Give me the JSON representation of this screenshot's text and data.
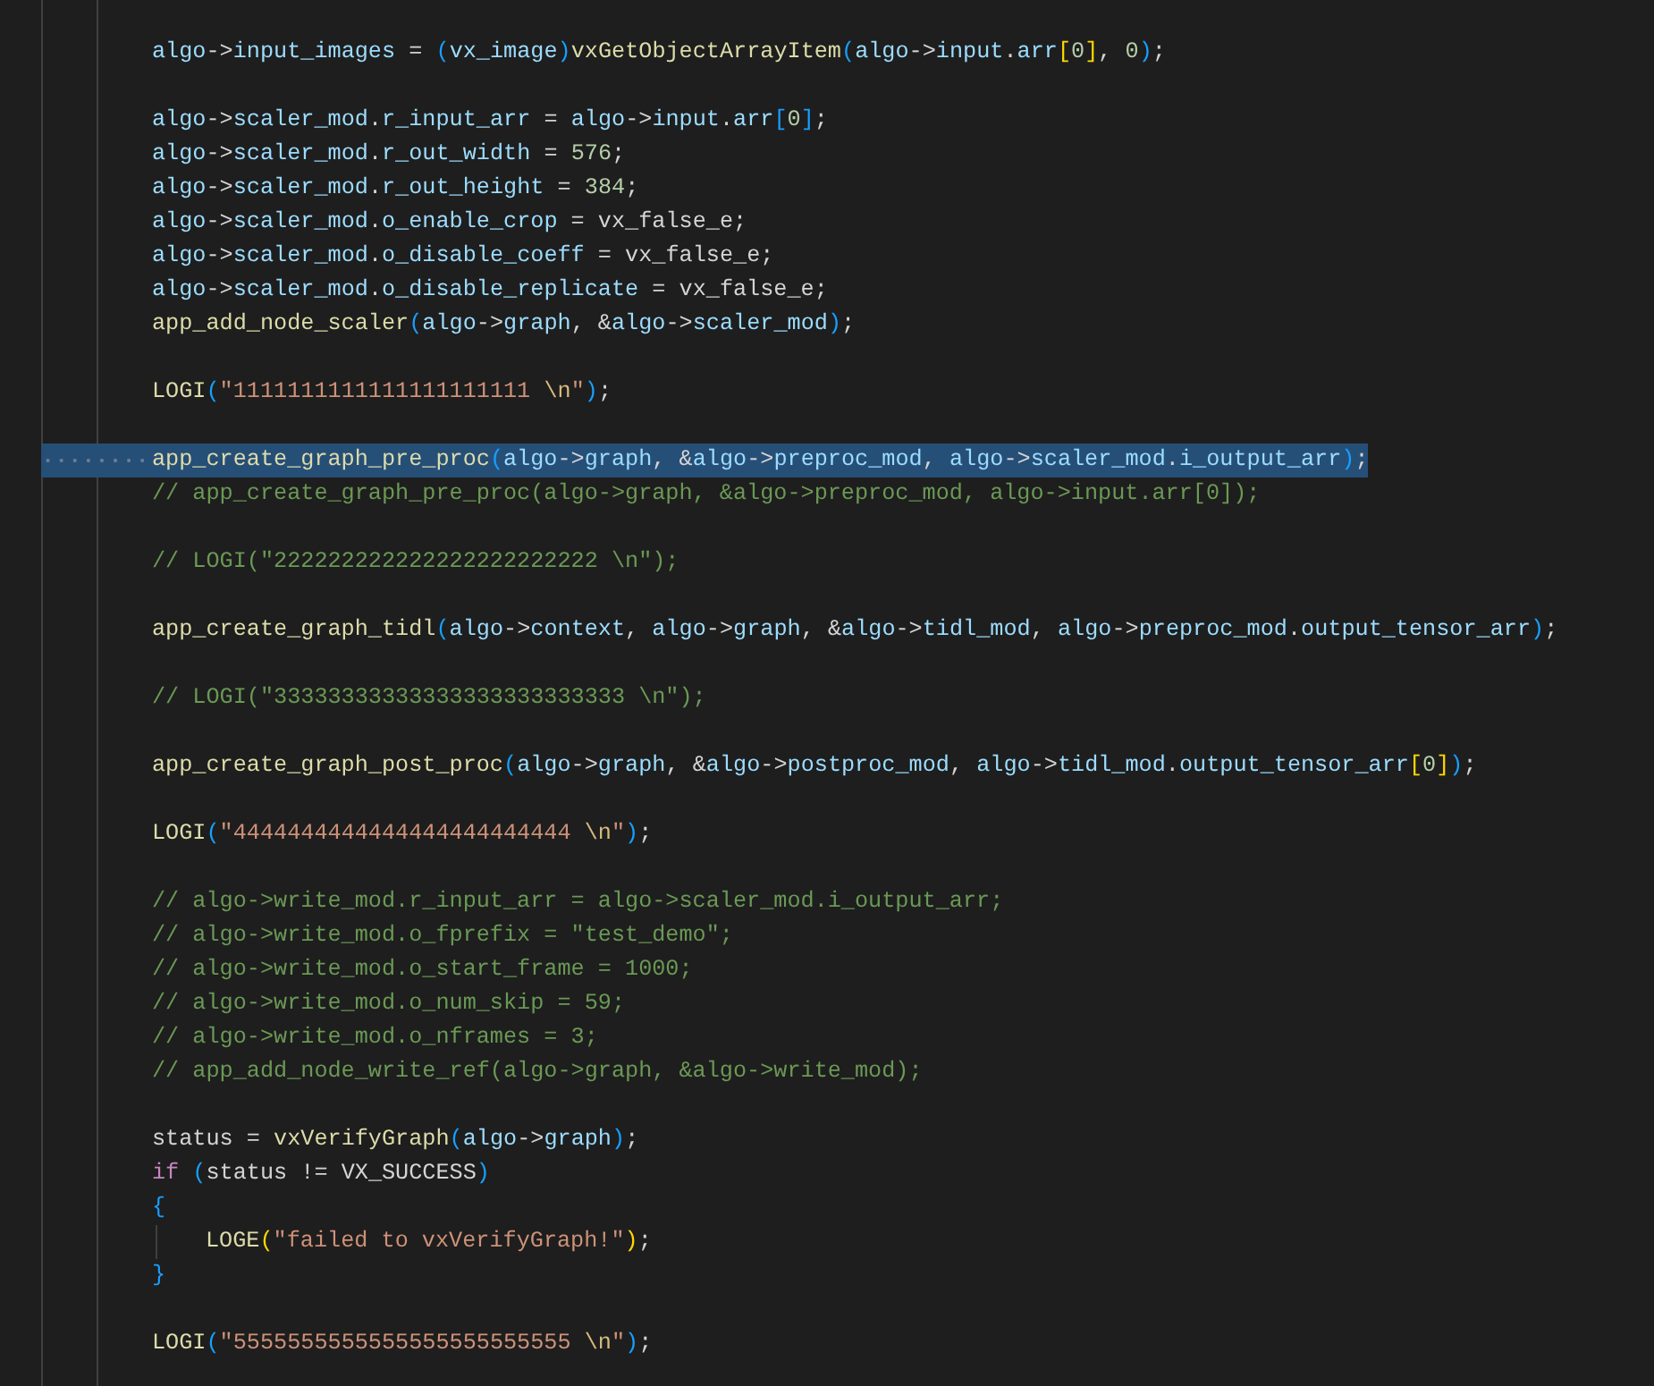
{
  "editor": {
    "lines": [
      {
        "kind": "code",
        "selected": false,
        "segments": [
          {
            "kind": "v",
            "text": "algo"
          },
          {
            "kind": "p",
            "text": "->"
          },
          {
            "kind": "v",
            "text": "input_images"
          },
          {
            "kind": "p",
            "text": " = "
          },
          {
            "kind": "b3",
            "text": "("
          },
          {
            "kind": "v",
            "text": "vx_image"
          },
          {
            "kind": "b3",
            "text": ")"
          },
          {
            "kind": "f",
            "text": "vxGetObjectArrayItem"
          },
          {
            "kind": "b3",
            "text": "("
          },
          {
            "kind": "v",
            "text": "algo"
          },
          {
            "kind": "p",
            "text": "->"
          },
          {
            "kind": "v",
            "text": "input"
          },
          {
            "kind": "p",
            "text": "."
          },
          {
            "kind": "v",
            "text": "arr"
          },
          {
            "kind": "b1",
            "text": "["
          },
          {
            "kind": "n",
            "text": "0"
          },
          {
            "kind": "b1",
            "text": "]"
          },
          {
            "kind": "p",
            "text": ", "
          },
          {
            "kind": "n",
            "text": "0"
          },
          {
            "kind": "b3",
            "text": ")"
          },
          {
            "kind": "p",
            "text": ";"
          }
        ]
      },
      {
        "kind": "blank"
      },
      {
        "kind": "code",
        "selected": false,
        "segments": [
          {
            "kind": "v",
            "text": "algo"
          },
          {
            "kind": "p",
            "text": "->"
          },
          {
            "kind": "v",
            "text": "scaler_mod"
          },
          {
            "kind": "p",
            "text": "."
          },
          {
            "kind": "v",
            "text": "r_input_arr"
          },
          {
            "kind": "p",
            "text": " = "
          },
          {
            "kind": "v",
            "text": "algo"
          },
          {
            "kind": "p",
            "text": "->"
          },
          {
            "kind": "v",
            "text": "input"
          },
          {
            "kind": "p",
            "text": "."
          },
          {
            "kind": "v",
            "text": "arr"
          },
          {
            "kind": "b3",
            "text": "["
          },
          {
            "kind": "n",
            "text": "0"
          },
          {
            "kind": "b3",
            "text": "]"
          },
          {
            "kind": "p",
            "text": ";"
          }
        ]
      },
      {
        "kind": "code",
        "selected": false,
        "segments": [
          {
            "kind": "v",
            "text": "algo"
          },
          {
            "kind": "p",
            "text": "->"
          },
          {
            "kind": "v",
            "text": "scaler_mod"
          },
          {
            "kind": "p",
            "text": "."
          },
          {
            "kind": "v",
            "text": "r_out_width"
          },
          {
            "kind": "p",
            "text": " = "
          },
          {
            "kind": "n",
            "text": "576"
          },
          {
            "kind": "p",
            "text": ";"
          }
        ]
      },
      {
        "kind": "code",
        "selected": false,
        "segments": [
          {
            "kind": "v",
            "text": "algo"
          },
          {
            "kind": "p",
            "text": "->"
          },
          {
            "kind": "v",
            "text": "scaler_mod"
          },
          {
            "kind": "p",
            "text": "."
          },
          {
            "kind": "v",
            "text": "r_out_height"
          },
          {
            "kind": "p",
            "text": " = "
          },
          {
            "kind": "n",
            "text": "384"
          },
          {
            "kind": "p",
            "text": ";"
          }
        ]
      },
      {
        "kind": "code",
        "selected": false,
        "segments": [
          {
            "kind": "v",
            "text": "algo"
          },
          {
            "kind": "p",
            "text": "->"
          },
          {
            "kind": "v",
            "text": "scaler_mod"
          },
          {
            "kind": "p",
            "text": "."
          },
          {
            "kind": "v",
            "text": "o_enable_crop"
          },
          {
            "kind": "p",
            "text": " = vx_false_e;"
          }
        ]
      },
      {
        "kind": "code",
        "selected": false,
        "segments": [
          {
            "kind": "v",
            "text": "algo"
          },
          {
            "kind": "p",
            "text": "->"
          },
          {
            "kind": "v",
            "text": "scaler_mod"
          },
          {
            "kind": "p",
            "text": "."
          },
          {
            "kind": "v",
            "text": "o_disable_coeff"
          },
          {
            "kind": "p",
            "text": " = vx_false_e;"
          }
        ]
      },
      {
        "kind": "code",
        "selected": false,
        "segments": [
          {
            "kind": "v",
            "text": "algo"
          },
          {
            "kind": "p",
            "text": "->"
          },
          {
            "kind": "v",
            "text": "scaler_mod"
          },
          {
            "kind": "p",
            "text": "."
          },
          {
            "kind": "v",
            "text": "o_disable_replicate"
          },
          {
            "kind": "p",
            "text": " = vx_false_e;"
          }
        ]
      },
      {
        "kind": "code",
        "selected": false,
        "segments": [
          {
            "kind": "f",
            "text": "app_add_node_scaler"
          },
          {
            "kind": "b3",
            "text": "("
          },
          {
            "kind": "v",
            "text": "algo"
          },
          {
            "kind": "p",
            "text": "->"
          },
          {
            "kind": "v",
            "text": "graph"
          },
          {
            "kind": "p",
            "text": ", &"
          },
          {
            "kind": "v",
            "text": "algo"
          },
          {
            "kind": "p",
            "text": "->"
          },
          {
            "kind": "v",
            "text": "scaler_mod"
          },
          {
            "kind": "b3",
            "text": ")"
          },
          {
            "kind": "p",
            "text": ";"
          }
        ]
      },
      {
        "kind": "blank"
      },
      {
        "kind": "code",
        "selected": false,
        "segments": [
          {
            "kind": "f",
            "text": "LOGI"
          },
          {
            "kind": "b3",
            "text": "("
          },
          {
            "kind": "s",
            "text": "\"1111111111111111111111 "
          },
          {
            "kind": "e",
            "text": "\\n"
          },
          {
            "kind": "s",
            "text": "\""
          },
          {
            "kind": "b3",
            "text": ")"
          },
          {
            "kind": "p",
            "text": ";"
          }
        ]
      },
      {
        "kind": "blank"
      },
      {
        "kind": "code",
        "selected": true,
        "segments": [
          {
            "kind": "f",
            "text": "app_create_graph_pre_proc"
          },
          {
            "kind": "b3",
            "text": "("
          },
          {
            "kind": "v",
            "text": "algo"
          },
          {
            "kind": "p",
            "text": "->"
          },
          {
            "kind": "v",
            "text": "graph"
          },
          {
            "kind": "p",
            "text": ", &"
          },
          {
            "kind": "v",
            "text": "algo"
          },
          {
            "kind": "p",
            "text": "->"
          },
          {
            "kind": "v",
            "text": "preproc_mod"
          },
          {
            "kind": "p",
            "text": ", "
          },
          {
            "kind": "v",
            "text": "algo"
          },
          {
            "kind": "p",
            "text": "->"
          },
          {
            "kind": "v",
            "text": "scaler_mod"
          },
          {
            "kind": "p",
            "text": "."
          },
          {
            "kind": "v",
            "text": "i_output_arr"
          },
          {
            "kind": "b3",
            "text": ")"
          },
          {
            "kind": "p",
            "text": ";"
          }
        ]
      },
      {
        "kind": "code",
        "selected": false,
        "segments": [
          {
            "kind": "c",
            "text": "// app_create_graph_pre_proc(algo->graph, &algo->preproc_mod, algo->input.arr[0]);"
          }
        ]
      },
      {
        "kind": "blank"
      },
      {
        "kind": "code",
        "selected": false,
        "segments": [
          {
            "kind": "c",
            "text": "// LOGI(\"222222222222222222222222 \\n\");"
          }
        ]
      },
      {
        "kind": "blank"
      },
      {
        "kind": "code",
        "selected": false,
        "segments": [
          {
            "kind": "f",
            "text": "app_create_graph_tidl"
          },
          {
            "kind": "b3",
            "text": "("
          },
          {
            "kind": "v",
            "text": "algo"
          },
          {
            "kind": "p",
            "text": "->"
          },
          {
            "kind": "v",
            "text": "context"
          },
          {
            "kind": "p",
            "text": ", "
          },
          {
            "kind": "v",
            "text": "algo"
          },
          {
            "kind": "p",
            "text": "->"
          },
          {
            "kind": "v",
            "text": "graph"
          },
          {
            "kind": "p",
            "text": ", &"
          },
          {
            "kind": "v",
            "text": "algo"
          },
          {
            "kind": "p",
            "text": "->"
          },
          {
            "kind": "v",
            "text": "tidl_mod"
          },
          {
            "kind": "p",
            "text": ", "
          },
          {
            "kind": "v",
            "text": "algo"
          },
          {
            "kind": "p",
            "text": "->"
          },
          {
            "kind": "v",
            "text": "preproc_mod"
          },
          {
            "kind": "p",
            "text": "."
          },
          {
            "kind": "v",
            "text": "output_tensor_arr"
          },
          {
            "kind": "b3",
            "text": ")"
          },
          {
            "kind": "p",
            "text": ";"
          }
        ]
      },
      {
        "kind": "blank"
      },
      {
        "kind": "code",
        "selected": false,
        "segments": [
          {
            "kind": "c",
            "text": "// LOGI(\"33333333333333333333333333 \\n\");"
          }
        ]
      },
      {
        "kind": "blank"
      },
      {
        "kind": "code",
        "selected": false,
        "segments": [
          {
            "kind": "f",
            "text": "app_create_graph_post_proc"
          },
          {
            "kind": "b3",
            "text": "("
          },
          {
            "kind": "v",
            "text": "algo"
          },
          {
            "kind": "p",
            "text": "->"
          },
          {
            "kind": "v",
            "text": "graph"
          },
          {
            "kind": "p",
            "text": ", &"
          },
          {
            "kind": "v",
            "text": "algo"
          },
          {
            "kind": "p",
            "text": "->"
          },
          {
            "kind": "v",
            "text": "postproc_mod"
          },
          {
            "kind": "p",
            "text": ", "
          },
          {
            "kind": "v",
            "text": "algo"
          },
          {
            "kind": "p",
            "text": "->"
          },
          {
            "kind": "v",
            "text": "tidl_mod"
          },
          {
            "kind": "p",
            "text": "."
          },
          {
            "kind": "v",
            "text": "output_tensor_arr"
          },
          {
            "kind": "b1",
            "text": "["
          },
          {
            "kind": "n",
            "text": "0"
          },
          {
            "kind": "b1",
            "text": "]"
          },
          {
            "kind": "b3",
            "text": ")"
          },
          {
            "kind": "p",
            "text": ";"
          }
        ]
      },
      {
        "kind": "blank"
      },
      {
        "kind": "code",
        "selected": false,
        "segments": [
          {
            "kind": "f",
            "text": "LOGI"
          },
          {
            "kind": "b3",
            "text": "("
          },
          {
            "kind": "s",
            "text": "\"4444444444444444444444444 "
          },
          {
            "kind": "e",
            "text": "\\n"
          },
          {
            "kind": "s",
            "text": "\""
          },
          {
            "kind": "b3",
            "text": ")"
          },
          {
            "kind": "p",
            "text": ";"
          }
        ]
      },
      {
        "kind": "blank"
      },
      {
        "kind": "code",
        "selected": false,
        "segments": [
          {
            "kind": "c",
            "text": "// algo->write_mod.r_input_arr = algo->scaler_mod.i_output_arr;"
          }
        ]
      },
      {
        "kind": "code",
        "selected": false,
        "segments": [
          {
            "kind": "c",
            "text": "// algo->write_mod.o_fprefix = \"test_demo\";"
          }
        ]
      },
      {
        "kind": "code",
        "selected": false,
        "segments": [
          {
            "kind": "c",
            "text": "// algo->write_mod.o_start_frame = 1000;"
          }
        ]
      },
      {
        "kind": "code",
        "selected": false,
        "segments": [
          {
            "kind": "c",
            "text": "// algo->write_mod.o_num_skip = 59;"
          }
        ]
      },
      {
        "kind": "code",
        "selected": false,
        "segments": [
          {
            "kind": "c",
            "text": "// algo->write_mod.o_nframes = 3;"
          }
        ]
      },
      {
        "kind": "code",
        "selected": false,
        "segments": [
          {
            "kind": "c",
            "text": "// app_add_node_write_ref(algo->graph, &algo->write_mod);"
          }
        ]
      },
      {
        "kind": "blank"
      },
      {
        "kind": "code",
        "selected": false,
        "segments": [
          {
            "kind": "p",
            "text": "status = "
          },
          {
            "kind": "f",
            "text": "vxVerifyGraph"
          },
          {
            "kind": "b3",
            "text": "("
          },
          {
            "kind": "v",
            "text": "algo"
          },
          {
            "kind": "p",
            "text": "->"
          },
          {
            "kind": "v",
            "text": "graph"
          },
          {
            "kind": "b3",
            "text": ")"
          },
          {
            "kind": "p",
            "text": ";"
          }
        ]
      },
      {
        "kind": "code",
        "selected": false,
        "segments": [
          {
            "kind": "k",
            "text": "if"
          },
          {
            "kind": "b3",
            "text": " ("
          },
          {
            "kind": "p",
            "text": "status != VX_SUCCESS"
          },
          {
            "kind": "b3",
            "text": ")"
          }
        ]
      },
      {
        "kind": "code",
        "selected": false,
        "segments": [
          {
            "kind": "b3",
            "text": "{"
          }
        ]
      },
      {
        "kind": "nested",
        "selected": false,
        "segments": [
          {
            "kind": "f",
            "text": "LOGE"
          },
          {
            "kind": "b1",
            "text": "("
          },
          {
            "kind": "s",
            "text": "\"failed to vxVerifyGraph!\""
          },
          {
            "kind": "b1",
            "text": ")"
          },
          {
            "kind": "p",
            "text": ";"
          }
        ]
      },
      {
        "kind": "code",
        "selected": false,
        "segments": [
          {
            "kind": "b3",
            "text": "}"
          }
        ]
      },
      {
        "kind": "blank"
      },
      {
        "kind": "code",
        "selected": false,
        "segments": [
          {
            "kind": "f",
            "text": "LOGI"
          },
          {
            "kind": "b3",
            "text": "("
          },
          {
            "kind": "s",
            "text": "\"5555555555555555555555555 "
          },
          {
            "kind": "e",
            "text": "\\n"
          },
          {
            "kind": "s",
            "text": "\""
          },
          {
            "kind": "b3",
            "text": ")"
          },
          {
            "kind": "p",
            "text": ";"
          }
        ]
      }
    ]
  }
}
